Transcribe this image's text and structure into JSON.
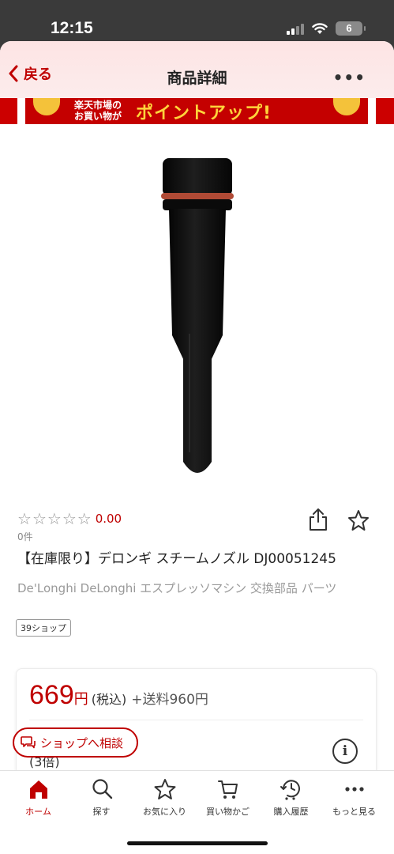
{
  "status_bar": {
    "time": "12:15",
    "battery": "6"
  },
  "nav": {
    "back_label": "戻る",
    "title": "商品詳細",
    "more_label": "•••"
  },
  "banner": {
    "small_text_1": "楽天市場の",
    "small_text_2": "お買い物が",
    "big_text": "ポイントアップ!"
  },
  "product": {
    "rating": "0.00",
    "review_count": "0件",
    "title": "【在庫限り】デロンギ スチームノズル DJ00051245",
    "subtitle": "De'Longhi DeLonghi エスプレッソマシン 交換部品 パーツ",
    "shop_tag": "39ショップ"
  },
  "price": {
    "amount": "669",
    "unit": "円",
    "tax": "(税込)",
    "shipping": "+送料960円",
    "times": "(3倍)"
  },
  "consult_button": {
    "label": "ショップへ相談"
  },
  "tabs": [
    {
      "label": "ホーム",
      "icon": "home-icon"
    },
    {
      "label": "探す",
      "icon": "search-icon"
    },
    {
      "label": "お気に入り",
      "icon": "star-icon"
    },
    {
      "label": "買い物かご",
      "icon": "cart-icon"
    },
    {
      "label": "購入履歴",
      "icon": "history-icon"
    },
    {
      "label": "もっと見る",
      "icon": "more-icon"
    }
  ],
  "colors": {
    "accent": "#bf0000",
    "nav_bg": "#fde4e4"
  }
}
